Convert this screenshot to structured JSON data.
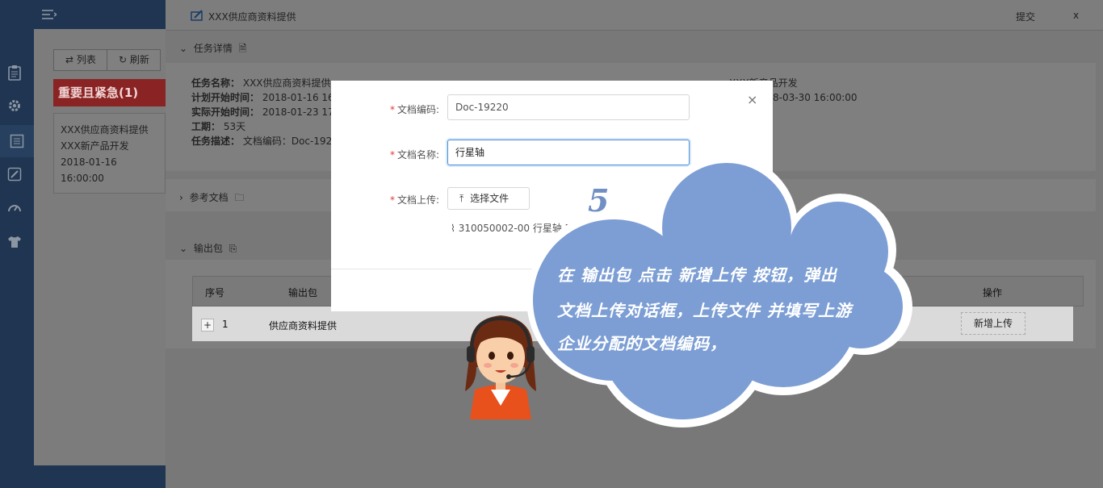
{
  "window": {
    "title": "XXX供应商资料提供",
    "submit_label": "提交",
    "close_label": "x"
  },
  "sidebar": {
    "icons": [
      "clipboard-icon",
      "gear-icon",
      "list-icon",
      "edit-icon",
      "speedometer-icon",
      "shirt-icon"
    ],
    "active_index": 2
  },
  "left_panel": {
    "list_button": "列表",
    "refresh_button": "刷新",
    "urgent_header": "重要且紧急(1)",
    "urgent_item": {
      "name": "XXX供应商资料提供",
      "project": "XXX新产品开发",
      "datetime": "2018-01-16 16:00:00"
    }
  },
  "task_detail": {
    "section_title": "任务详情",
    "name_label": "任务名称：",
    "name_value": "XXX供应商资料提供",
    "plan_start_label": "计划开始时间：",
    "plan_start_value": "2018-01-16 16",
    "actual_start_label": "实际开始时间：",
    "actual_start_value": "2018-01-23 17",
    "duration_label": "工期：",
    "duration_value": "53天",
    "desc_label": "任务描述：",
    "desc_value": "文档编码：Doc-192",
    "project_partial": "XXX新产品开发",
    "plan_end_partial": "8-03-30 16:00:00"
  },
  "ref_docs": {
    "section_title": "参考文档"
  },
  "output_pkg": {
    "section_title": "输出包",
    "columns": [
      "序号",
      "输出包",
      "操作"
    ],
    "rows": [
      {
        "index": "1",
        "name": "供应商资料提供",
        "action": "新增上传"
      }
    ]
  },
  "upload_dialog": {
    "doc_code_label": "文档编码:",
    "doc_code_value": "Doc-19220",
    "doc_name_label": "文档名称:",
    "doc_name_value": "行星轴",
    "upload_label": "文档上传:",
    "choose_file_label": "选择文件",
    "attached_file": "310050002-00 行星轴.DWG",
    "close_label": "×"
  },
  "callout": {
    "step": "5",
    "line1": "在 输出包 点击 新增上传 按钮，弹出",
    "line2": "文档上传对话框，上传文件 并填写上游",
    "line3": "企业分配的文档编码，"
  },
  "colors": {
    "cloud": "#7c9ed4",
    "required": "#e23a3a",
    "focus_border": "#4a90d9"
  }
}
